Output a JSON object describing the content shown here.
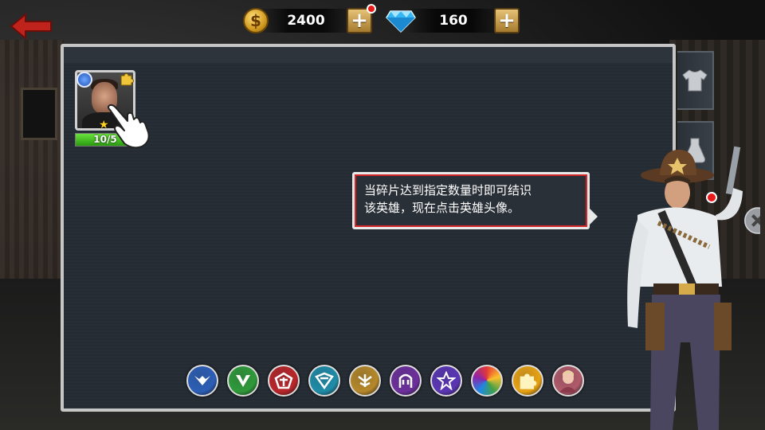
{
  "top_bar": {
    "back_icon": "back-arrow-icon",
    "gold": {
      "icon": "gold-coin-icon",
      "symbol": "$",
      "amount": "2400",
      "add_label": "+",
      "has_notification": true
    },
    "gems": {
      "icon": "diamond-icon",
      "amount": "160",
      "add_label": "+",
      "has_notification": false
    }
  },
  "hero_card": {
    "tier_icon": "blue-tier-icon",
    "fragment_icon": "puzzle-icon",
    "stars": "★",
    "progress_text": "10/5",
    "progress_fraction": 1.0
  },
  "tooltip": {
    "text_line1": "当碎片达到指定数量时即可结识",
    "text_line2": "该英雄，现在点击英雄头像。"
  },
  "side_tabs": [
    {
      "icon": "shirt-icon"
    },
    {
      "icon": "potion-icon"
    },
    {
      "icon": "close-icon"
    }
  ],
  "filters": [
    {
      "icon": "blue-wings-faction-icon",
      "color": "#2d5fb7"
    },
    {
      "icon": "green-v-faction-icon",
      "color": "#2f9a3a"
    },
    {
      "icon": "red-crest-faction-icon",
      "color": "#b8262a"
    },
    {
      "icon": "teal-eagle-faction-icon",
      "color": "#1f8ca8"
    },
    {
      "icon": "gold-phoenix-faction-icon",
      "color": "#b5882a"
    },
    {
      "icon": "purple-helm-faction-icon",
      "color": "#6d2f9c"
    },
    {
      "icon": "violet-star-faction-icon",
      "color": "#5b36b5"
    },
    {
      "icon": "rainbow-all-icon",
      "color": "#e0a020"
    },
    {
      "icon": "puzzle-fragment-icon",
      "color": "#e7a214"
    },
    {
      "icon": "hero-portrait-icon",
      "color": "#b05a6a"
    }
  ],
  "colors": {
    "panel_bg": "#252b33",
    "accent_red": "#d32727",
    "progress_green": "#3fc41d"
  }
}
